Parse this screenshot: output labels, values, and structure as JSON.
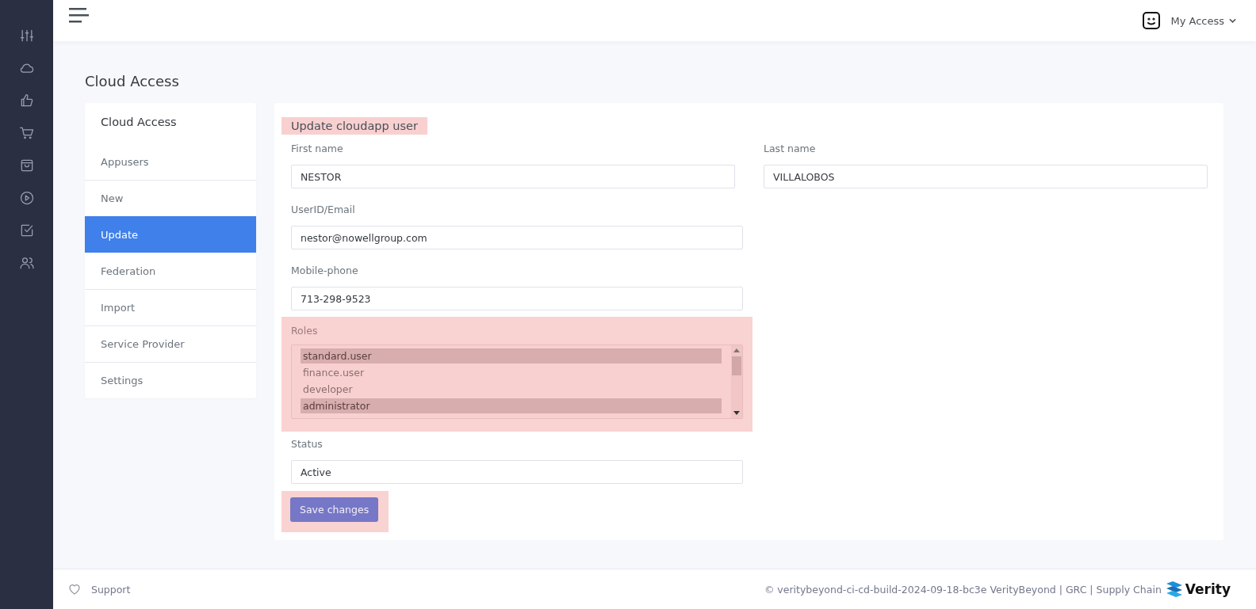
{
  "topbar": {
    "user_menu": "My Access"
  },
  "page_title": "Cloud Access",
  "nav": {
    "title": "Cloud Access",
    "items": [
      {
        "label": "Appusers",
        "selected": false
      },
      {
        "label": "New",
        "selected": false
      },
      {
        "label": "Update",
        "selected": true
      },
      {
        "label": "Federation",
        "selected": false
      },
      {
        "label": "Import",
        "selected": false
      },
      {
        "label": "Service Provider",
        "selected": false
      },
      {
        "label": "Settings",
        "selected": false
      }
    ]
  },
  "form": {
    "title": "Update cloudapp user",
    "title_highlighted": true,
    "first_name": {
      "label": "First name",
      "value": "NESTOR"
    },
    "last_name": {
      "label": "Last name",
      "value": "VILLALOBOS"
    },
    "email": {
      "label": "UserID/Email",
      "value": "nestor@nowellgroup.com"
    },
    "phone": {
      "label": "Mobile-phone",
      "value": "713-298-9523"
    },
    "roles": {
      "label": "Roles",
      "highlighted": true,
      "options": [
        {
          "label": "standard.user",
          "selected": true
        },
        {
          "label": "finance.user",
          "selected": false
        },
        {
          "label": "developer",
          "selected": false
        },
        {
          "label": "administrator",
          "selected": true
        }
      ]
    },
    "status": {
      "label": "Status",
      "value": "Active"
    },
    "save_button": {
      "label": "Save changes",
      "highlighted": true
    }
  },
  "footer": {
    "support": "Support",
    "copyright": "© veritybeyond-ci-cd-build-2024-09-18-bc3e VerityBeyond | GRC | Supply Chain",
    "logo_text": "Verity"
  }
}
